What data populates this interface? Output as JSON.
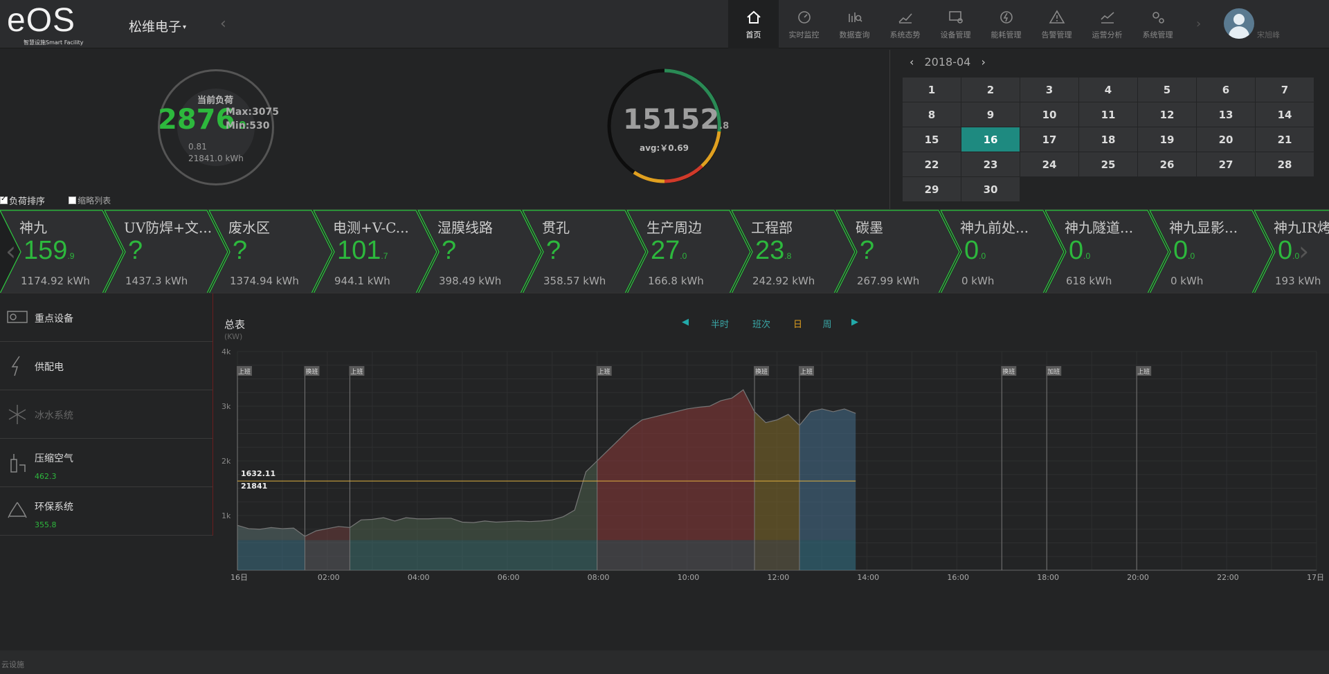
{
  "header": {
    "logo_text": "eOS",
    "logo_sub": "智慧设施Smart Facility",
    "company": "松维电子",
    "nav": [
      {
        "label": "首页",
        "icon": "home-icon",
        "active": true
      },
      {
        "label": "实时监控",
        "icon": "speedometer-icon"
      },
      {
        "label": "数据查询",
        "icon": "data-search-icon"
      },
      {
        "label": "系统态势",
        "icon": "trend-chart-icon"
      },
      {
        "label": "设备管理",
        "icon": "device-settings-icon"
      },
      {
        "label": "能耗管理",
        "icon": "energy-icon"
      },
      {
        "label": "告警管理",
        "icon": "warning-icon"
      },
      {
        "label": "运营分析",
        "icon": "analysis-icon"
      },
      {
        "label": "系统管理",
        "icon": "gears-icon"
      }
    ],
    "username": "宋旭峰"
  },
  "load_gauge": {
    "title": "当前负荷",
    "value": "2876",
    "decimal": ".0",
    "max": "Max:3075",
    "min": "Min:530",
    "power_factor": "0.81",
    "energy": "21841.0 kWh"
  },
  "cost_gauge": {
    "value": "15152",
    "decimal": ".8",
    "avg": "avg:￥0.69"
  },
  "calendar": {
    "month": "2018-04",
    "days": [
      "1",
      "2",
      "3",
      "4",
      "5",
      "6",
      "7",
      "8",
      "9",
      "10",
      "11",
      "12",
      "13",
      "14",
      "15",
      "16",
      "17",
      "18",
      "19",
      "20",
      "21",
      "22",
      "23",
      "24",
      "25",
      "26",
      "27",
      "28",
      "29",
      "30"
    ],
    "selected": "16"
  },
  "options": {
    "sort_by_load": "负荷排序",
    "thumbnail_list": "缩略列表"
  },
  "circuits": [
    {
      "name": "神九",
      "value": "159",
      "decimal": ".9",
      "energy": "1174.92 kWh"
    },
    {
      "name": "UV防焊+文...",
      "value": "?",
      "decimal": "",
      "energy": "1437.3 kWh"
    },
    {
      "name": "废水区",
      "value": "?",
      "decimal": "",
      "energy": "1374.94 kWh"
    },
    {
      "name": "电测+V-C...",
      "value": "101",
      "decimal": ".7",
      "energy": "944.1 kWh"
    },
    {
      "name": "湿膜线路",
      "value": "?",
      "decimal": "",
      "energy": "398.49 kWh"
    },
    {
      "name": "贯孔",
      "value": "?",
      "decimal": "",
      "energy": "358.57 kWh"
    },
    {
      "name": "生产周边",
      "value": "27",
      "decimal": ".0",
      "energy": "166.8 kWh"
    },
    {
      "name": "工程部",
      "value": "23",
      "decimal": ".8",
      "energy": "242.92 kWh"
    },
    {
      "name": "碳墨",
      "value": "?",
      "decimal": "",
      "energy": "267.99 kWh"
    },
    {
      "name": "神九前处...",
      "value": "0",
      "decimal": ".0",
      "energy": "0 kWh"
    },
    {
      "name": "神九隧道...",
      "value": "0",
      "decimal": ".0",
      "energy": "618 kWh"
    },
    {
      "name": "神九显影...",
      "value": "0",
      "decimal": ".0",
      "energy": "0 kWh"
    },
    {
      "name": "神九IR烤",
      "value": "0",
      "decimal": ".0",
      "energy": "193 kWh"
    }
  ],
  "sidebar": [
    {
      "label": "重点设备",
      "icon": "key-device-icon",
      "sub": ""
    },
    {
      "label": "供配电",
      "icon": "lightning-icon",
      "sub": ""
    },
    {
      "label": "冰水系统",
      "icon": "snowflake-icon",
      "sub": "",
      "dim": true
    },
    {
      "label": "压缩空气",
      "icon": "compressor-icon",
      "sub": "462.3"
    },
    {
      "label": "环保系统",
      "icon": "recycle-icon",
      "sub": "355.8"
    }
  ],
  "chart_header": {
    "title": "总表",
    "unit": "(KW)",
    "tabs": [
      "半时",
      "班次",
      "日",
      "周"
    ],
    "active_tab": "日"
  },
  "chart_data": {
    "type": "area",
    "ylim": [
      0,
      4000
    ],
    "yticks": [
      "1k",
      "2k",
      "3k",
      "4k"
    ],
    "xticks": [
      "16日",
      "02:00",
      "04:00",
      "06:00",
      "08:00",
      "10:00",
      "12:00",
      "14:00",
      "16:00",
      "18:00",
      "20:00",
      "22:00",
      "17日"
    ],
    "x_hours": [
      0,
      0.25,
      0.5,
      0.75,
      1,
      1.25,
      1.5,
      1.75,
      2,
      2.25,
      2.5,
      2.75,
      3,
      3.25,
      3.5,
      3.75,
      4,
      4.25,
      4.5,
      4.75,
      5,
      5.25,
      5.5,
      5.75,
      6,
      6.25,
      6.5,
      6.75,
      7,
      7.25,
      7.5,
      7.75,
      8,
      8.25,
      8.5,
      8.75,
      9,
      9.25,
      9.5,
      9.75,
      10,
      10.25,
      10.5,
      10.75,
      11,
      11.25,
      11.5,
      11.75,
      12,
      12.25,
      12.5,
      12.75,
      13,
      13.25,
      13.5,
      13.75
    ],
    "values": [
      820,
      760,
      750,
      780,
      760,
      770,
      620,
      720,
      760,
      800,
      780,
      920,
      930,
      960,
      900,
      960,
      940,
      940,
      950,
      950,
      880,
      870,
      900,
      880,
      890,
      900,
      890,
      900,
      920,
      980,
      1100,
      1800,
      2000,
      2200,
      2400,
      2600,
      2750,
      2800,
      2850,
      2900,
      2950,
      2980,
      3000,
      3100,
      3150,
      3300,
      2900,
      2700,
      2750,
      2850,
      2650,
      2900,
      2950,
      2900,
      2950,
      2870
    ],
    "shift_markers": [
      {
        "hour": 0,
        "label": "上班"
      },
      {
        "hour": 1.5,
        "label": "换班"
      },
      {
        "hour": 2.5,
        "label": "上班"
      },
      {
        "hour": 8,
        "label": "上班"
      },
      {
        "hour": 11.5,
        "label": "换班"
      },
      {
        "hour": 12.5,
        "label": "上班"
      },
      {
        "hour": 17,
        "label": "换班"
      },
      {
        "hour": 18,
        "label": "加班"
      },
      {
        "hour": 20,
        "label": "上班"
      }
    ],
    "reference_value": "1632.11",
    "reference_total": "21841",
    "reference_kw": 1632.11,
    "base_level": 550,
    "end_hour": 13.75
  },
  "footer": {
    "text": "云设施"
  }
}
